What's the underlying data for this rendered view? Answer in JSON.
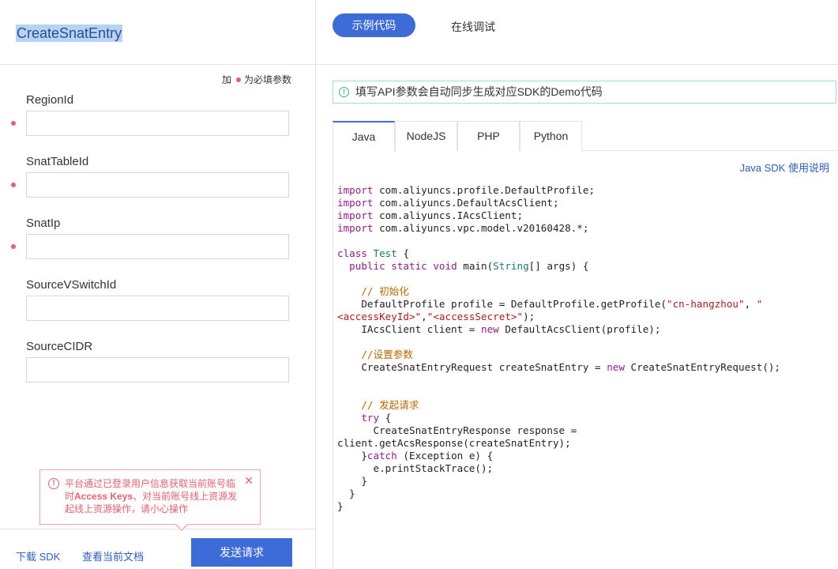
{
  "left": {
    "api_name": "CreateSnatEntry",
    "required_prefix": "加",
    "required_suffix": "为必填参数",
    "fields": [
      {
        "label": "RegionId",
        "value": "",
        "required": true
      },
      {
        "label": "SnatTableId",
        "value": "",
        "required": true
      },
      {
        "label": "SnatIp",
        "value": "",
        "required": true
      },
      {
        "label": "SourceVSwitchId",
        "value": "",
        "required": false
      },
      {
        "label": "SourceCIDR",
        "value": "",
        "required": false
      }
    ],
    "warning": {
      "line1": "平台通过已登录用户信息获取当前账号临",
      "line2a": "时",
      "line2b": "Access Keys",
      "line2c": "、对当前账号线上资源发",
      "line3": "起线上资源操作，请小心操作",
      "close": "✕",
      "icon": "!"
    },
    "footer": {
      "download_sdk": "下载 SDK",
      "view_doc": "查看当前文档",
      "send": "发送请求"
    }
  },
  "right": {
    "tabs": {
      "active": "示例代码",
      "other": "在线调试"
    },
    "info": "填写API参数会自动同步生成对应SDK的Demo代码",
    "info_icon": "!",
    "langs": [
      "Java",
      "NodeJS",
      "PHP",
      "Python"
    ],
    "active_lang": "Java",
    "sdk_link": "Java SDK 使用说明"
  },
  "colors": {
    "accent": "#3d6bd8",
    "warning": "#e4606d",
    "info": "#3fae8a"
  }
}
